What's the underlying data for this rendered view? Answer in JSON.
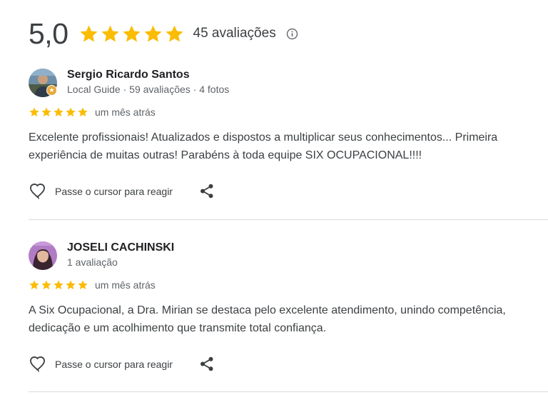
{
  "summary": {
    "rating": "5,0",
    "stars": 5,
    "review_count": "45 avaliações",
    "info_icon": "info-icon",
    "star_color": "#fbbc04"
  },
  "reviews": [
    {
      "author": "Sergio Ricardo Santos",
      "meta": "Local Guide · 59 avaliações · 4 fotos",
      "stars": 5,
      "date": "um mês atrás",
      "text": "Excelente profissionais! Atualizados e dispostos a multiplicar seus conhecimentos... Primeira experiência de muitas outras! Parabéns à toda equipe SIX OCUPACIONAL!!!!",
      "like_label": "Passe o cursor para reagir",
      "local_guide_badge": true
    },
    {
      "author": "JOSELI CACHINSKI",
      "meta": "1 avaliação",
      "stars": 5,
      "date": "um mês atrás",
      "text": "A Six Ocupacional, a Dra. Mirian se destaca pelo excelente atendimento, unindo competência, dedicação e um acolhimento que transmite total confiança.",
      "like_label": "Passe o cursor para reagir",
      "local_guide_badge": false
    }
  ],
  "icons": {
    "like": "heart-outline-icon",
    "share": "share-icon"
  }
}
